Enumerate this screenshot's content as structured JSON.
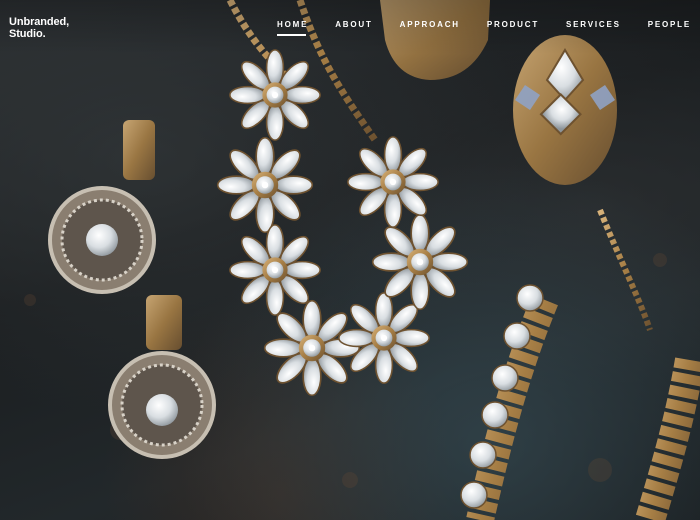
{
  "brand": {
    "name": "Unbranded,\nStudio."
  },
  "nav": {
    "items": [
      {
        "label": "HOME",
        "active": true
      },
      {
        "label": "ABOUT",
        "active": false
      },
      {
        "label": "APPROACH",
        "active": false
      },
      {
        "label": "PRODUCT",
        "active": false
      },
      {
        "label": "SERVICES",
        "active": false
      },
      {
        "label": "PEOPLE",
        "active": false
      }
    ]
  },
  "hero": {
    "subject": "jewelry-photo",
    "colors": {
      "background": "#1f2326",
      "gold": "#b08a4e",
      "crystal": "#e8ecef"
    }
  }
}
